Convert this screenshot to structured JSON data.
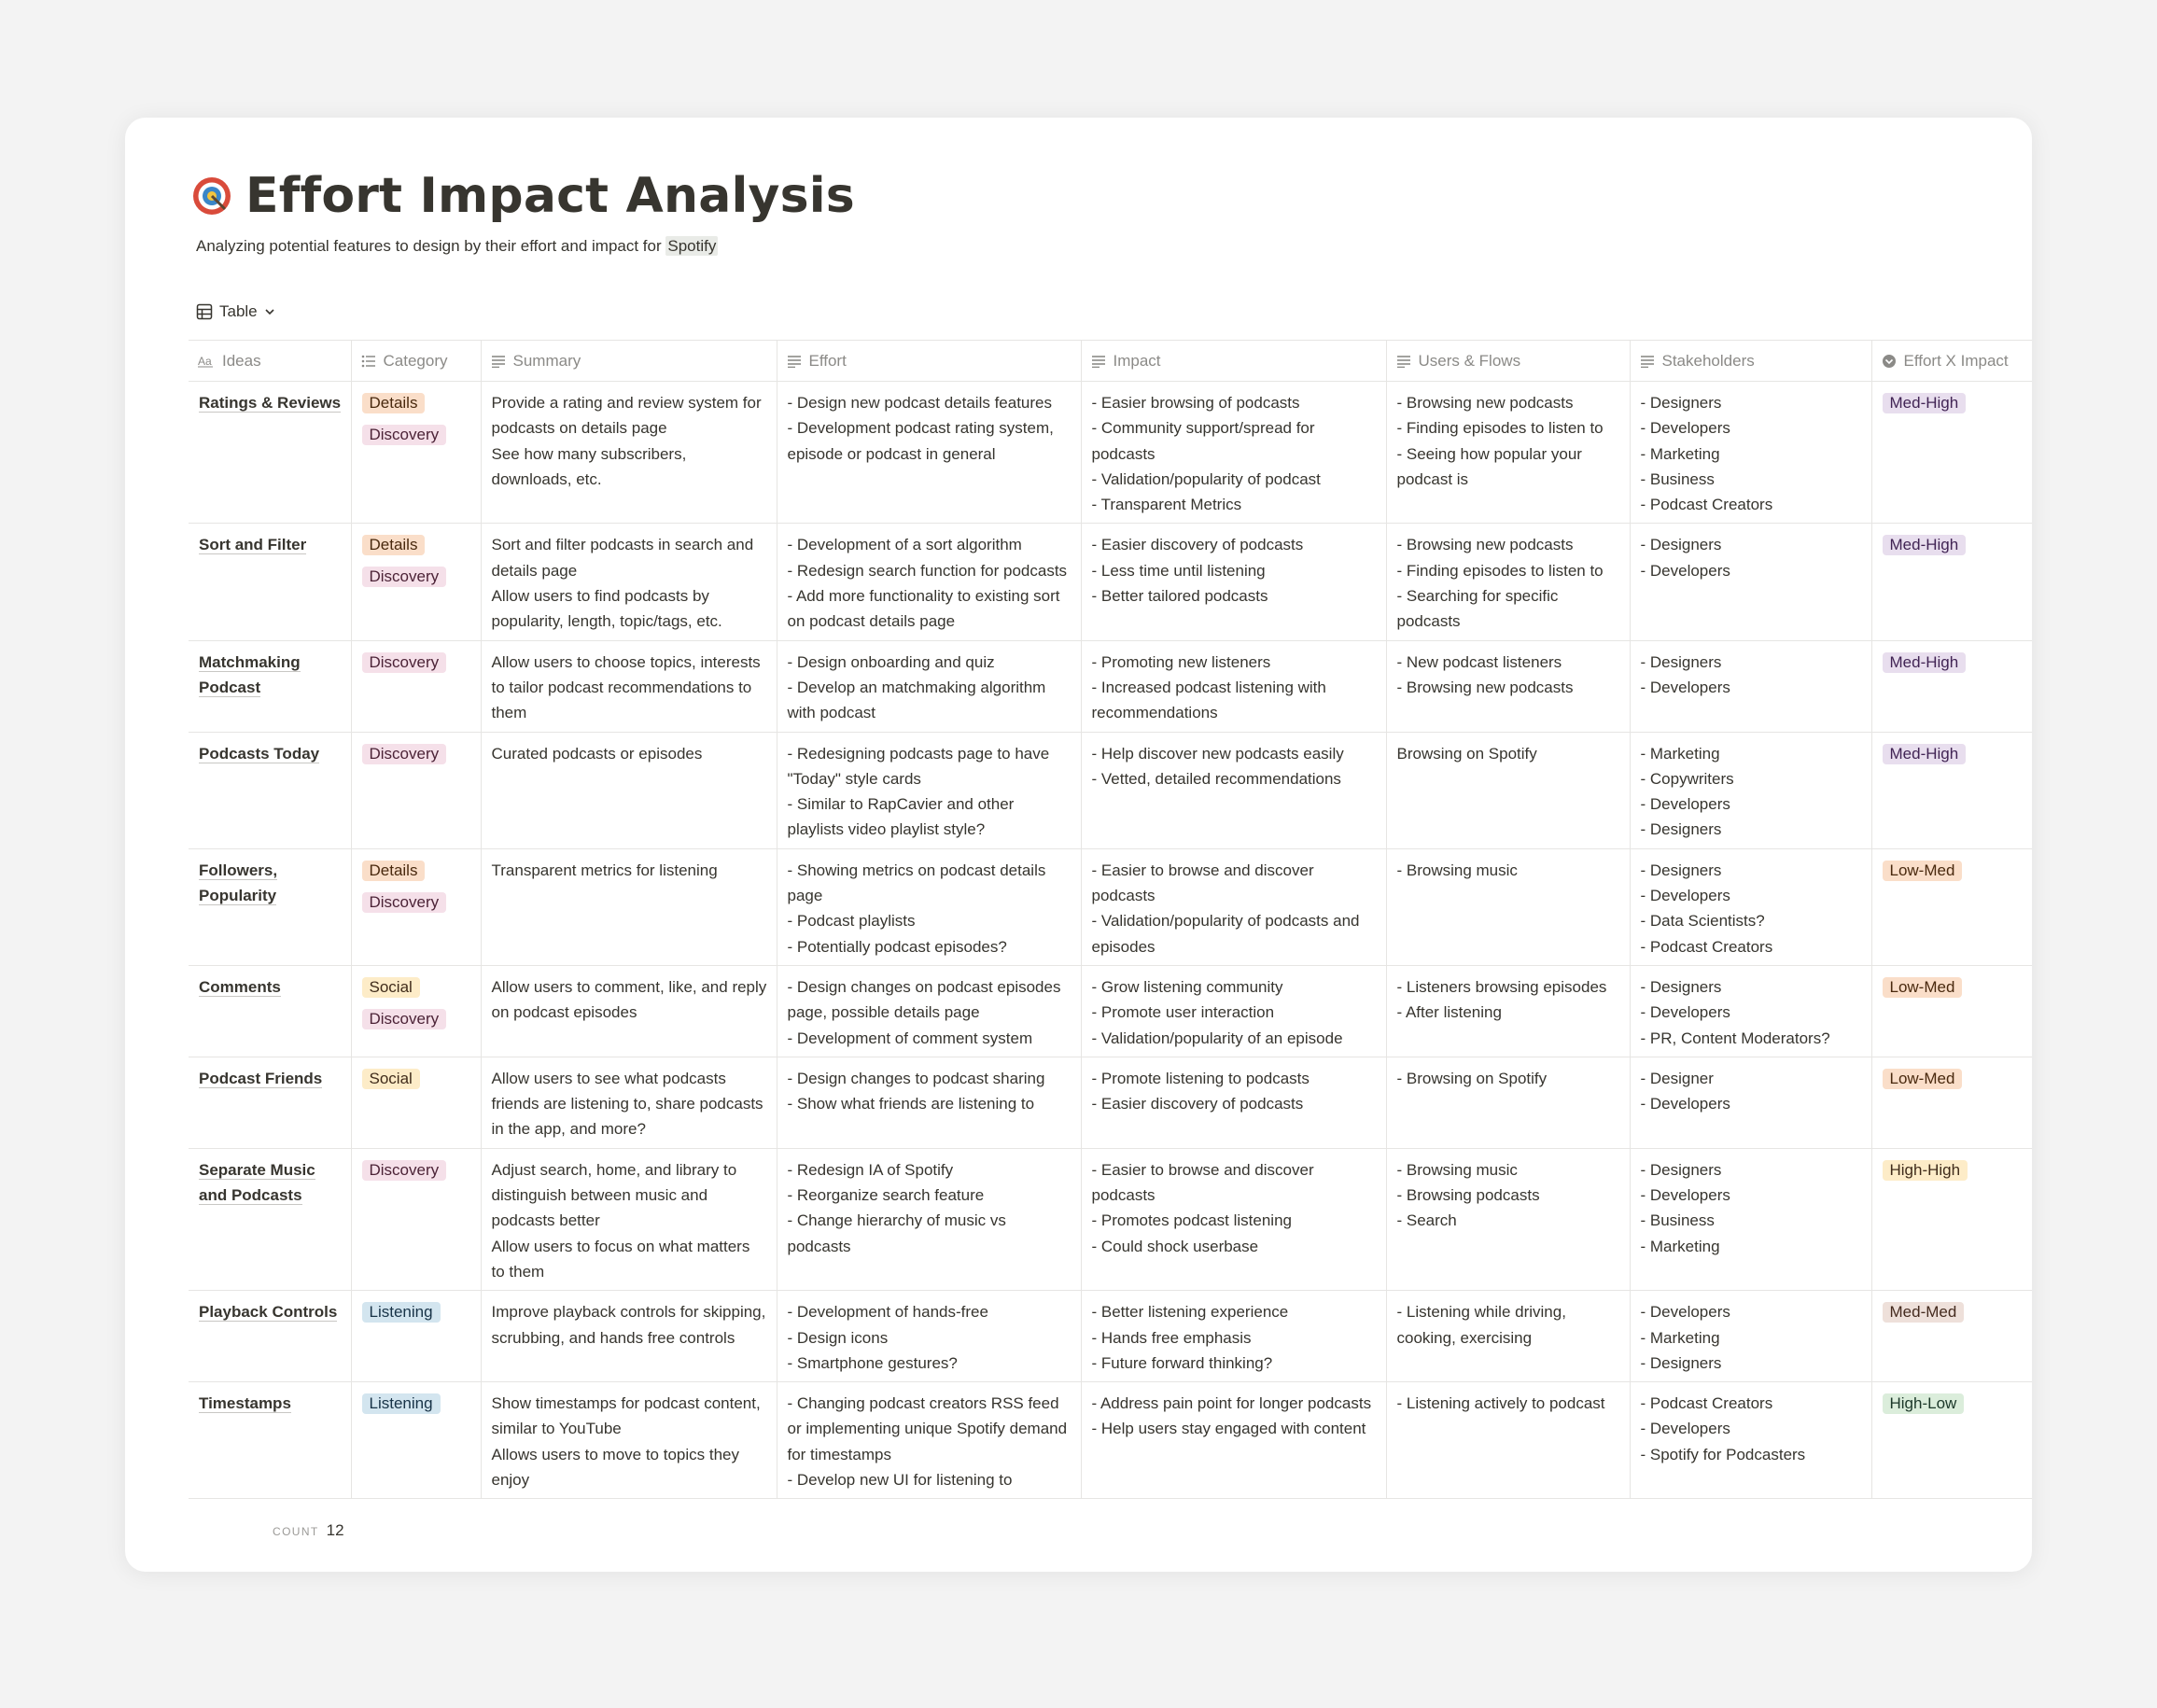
{
  "page": {
    "title": "Effort Impact Analysis",
    "icon": "target-icon",
    "subtitle_prefix": "Analyzing potential features to design by their effort and impact for ",
    "subtitle_highlight": "Spotify"
  },
  "view": {
    "label": "Table",
    "icon": "table-icon"
  },
  "columns": [
    {
      "label": "Ideas",
      "icon": "title-icon"
    },
    {
      "label": "Category",
      "icon": "multi-select-icon"
    },
    {
      "label": "Summary",
      "icon": "text-icon"
    },
    {
      "label": "Effort",
      "icon": "text-icon"
    },
    {
      "label": "Impact",
      "icon": "text-icon"
    },
    {
      "label": "Users & Flows",
      "icon": "text-icon"
    },
    {
      "label": "Stakeholders",
      "icon": "text-icon"
    },
    {
      "label": "Effort X Impact",
      "icon": "select-icon"
    }
  ],
  "tag_colors": {
    "Details": {
      "bg": "#fadec9",
      "fg": "#49290e"
    },
    "Discovery": {
      "bg": "#f5e0e9",
      "fg": "#4c2337"
    },
    "Social": {
      "bg": "#fdecc8",
      "fg": "#402c1b"
    },
    "Listening": {
      "bg": "#d3e5ef",
      "fg": "#183347"
    },
    "Med-High": {
      "bg": "#e8deee",
      "fg": "#412454"
    },
    "Low-Med": {
      "bg": "#fadec9",
      "fg": "#49290e"
    },
    "High-High": {
      "bg": "#fdecc8",
      "fg": "#402c1b"
    },
    "Med-Med": {
      "bg": "#eee0da",
      "fg": "#442a1e"
    },
    "High-Low": {
      "bg": "#dbeddb",
      "fg": "#1c3829"
    }
  },
  "rows": [
    {
      "idea": "Ratings & Reviews",
      "categories": [
        "Details",
        "Discovery"
      ],
      "summary": [
        "Provide a rating and review system for podcasts on details page",
        "See how many subscribers, downloads, etc."
      ],
      "effort": [
        "- Design new podcast details features",
        "- Development podcast rating system, episode or podcast in general"
      ],
      "impact": [
        "- Easier browsing of podcasts",
        "- Community support/spread for podcasts",
        "- Validation/popularity of podcast",
        "- Transparent Metrics"
      ],
      "users_flows": [
        "- Browsing new podcasts",
        "- Finding episodes to listen to",
        "- Seeing how popular your podcast is"
      ],
      "stakeholders": [
        "- Designers",
        "- Developers",
        "- Marketing",
        "- Business",
        "- Podcast Creators"
      ],
      "effort_x_impact": "Med-High"
    },
    {
      "idea": "Sort and Filter",
      "categories": [
        "Details",
        "Discovery"
      ],
      "summary": [
        "Sort and filter podcasts in search and details page",
        "Allow users to find podcasts by popularity, length, topic/tags, etc."
      ],
      "effort": [
        "- Development of a sort algorithm",
        "- Redesign search function for podcasts",
        "- Add more functionality to existing sort on podcast details page"
      ],
      "impact": [
        "- Easier discovery of podcasts",
        "- Less time until listening",
        "- Better tailored podcasts"
      ],
      "users_flows": [
        "- Browsing new podcasts",
        "- Finding episodes to listen to",
        "- Searching for specific podcasts"
      ],
      "stakeholders": [
        "- Designers",
        "- Developers"
      ],
      "effort_x_impact": "Med-High"
    },
    {
      "idea": "Matchmaking Podcast",
      "categories": [
        "Discovery"
      ],
      "summary": [
        "Allow users to choose topics, interests to tailor podcast recommendations to them"
      ],
      "effort": [
        "- Design onboarding and quiz",
        "- Develop an matchmaking algorithm with podcast"
      ],
      "impact": [
        "- Promoting new listeners",
        "- Increased podcast listening with recommendations"
      ],
      "users_flows": [
        "- New podcast listeners",
        "- Browsing new podcasts"
      ],
      "stakeholders": [
        "- Designers",
        "- Developers"
      ],
      "effort_x_impact": "Med-High"
    },
    {
      "idea": "Podcasts Today",
      "categories": [
        "Discovery"
      ],
      "summary": [
        "Curated podcasts or episodes"
      ],
      "effort": [
        "- Redesigning podcasts page to have \"Today\" style cards",
        "- Similar to RapCavier and other playlists video playlist style?"
      ],
      "impact": [
        "- Help discover new podcasts easily",
        "- Vetted, detailed recommendations"
      ],
      "users_flows": [
        "Browsing on Spotify"
      ],
      "stakeholders": [
        "- Marketing",
        "- Copywriters",
        "- Developers",
        "- Designers"
      ],
      "effort_x_impact": "Med-High"
    },
    {
      "idea": "Followers, Popularity",
      "categories": [
        "Details",
        "Discovery"
      ],
      "summary": [
        "Transparent metrics for listening"
      ],
      "effort": [
        "- Showing metrics on podcast details page",
        "- Podcast playlists",
        "- Potentially podcast episodes?"
      ],
      "impact": [
        "- Easier to browse and discover podcasts",
        "- Validation/popularity of podcasts and episodes"
      ],
      "users_flows": [
        "- Browsing music"
      ],
      "stakeholders": [
        "- Designers",
        "- Developers",
        "- Data Scientists?",
        "- Podcast Creators"
      ],
      "effort_x_impact": "Low-Med"
    },
    {
      "idea": "Comments",
      "categories": [
        "Social",
        "Discovery"
      ],
      "summary": [
        "Allow users to comment, like, and reply on podcast episodes"
      ],
      "effort": [
        "- Design changes on podcast episodes page, possible details page",
        "- Development of comment system"
      ],
      "impact": [
        "- Grow listening community",
        "- Promote user interaction",
        "- Validation/popularity of an episode"
      ],
      "users_flows": [
        "- Listeners browsing episodes",
        "- After listening"
      ],
      "stakeholders": [
        "- Designers",
        "- Developers",
        "- PR, Content Moderators?"
      ],
      "effort_x_impact": "Low-Med"
    },
    {
      "idea": "Podcast Friends",
      "categories": [
        "Social"
      ],
      "summary": [
        "Allow users to see what podcasts friends are listening to, share podcasts in the app, and more?"
      ],
      "effort": [
        "- Design changes to podcast sharing",
        "- Show what friends are listening to"
      ],
      "impact": [
        "- Promote listening to podcasts",
        "- Easier discovery of podcasts"
      ],
      "users_flows": [
        "- Browsing on Spotify"
      ],
      "stakeholders": [
        "- Designer",
        "- Developers"
      ],
      "effort_x_impact": "Low-Med"
    },
    {
      "idea": "Separate Music and Podcasts",
      "categories": [
        "Discovery"
      ],
      "summary": [
        "Adjust search, home, and library to distinguish between music and podcasts better",
        "Allow users to focus on what matters to them"
      ],
      "effort": [
        "- Redesign IA of Spotify",
        "- Reorganize search feature",
        "- Change hierarchy of music vs podcasts"
      ],
      "impact": [
        "- Easier to browse and discover podcasts",
        "- Promotes podcast listening",
        "- Could shock userbase"
      ],
      "users_flows": [
        "- Browsing music",
        "- Browsing podcasts",
        "- Search"
      ],
      "stakeholders": [
        "- Designers",
        "- Developers",
        "- Business",
        "- Marketing"
      ],
      "effort_x_impact": "High-High"
    },
    {
      "idea": "Playback Controls",
      "categories": [
        "Listening"
      ],
      "summary": [
        "Improve playback controls for skipping, scrubbing, and hands free controls"
      ],
      "effort": [
        "- Development of hands-free",
        "- Design icons",
        "- Smartphone gestures?"
      ],
      "impact": [
        "- Better listening experience",
        "- Hands free emphasis",
        "- Future forward thinking?"
      ],
      "users_flows": [
        "- Listening while driving, cooking, exercising"
      ],
      "stakeholders": [
        "- Developers",
        "- Marketing",
        "- Designers"
      ],
      "effort_x_impact": "Med-Med"
    },
    {
      "idea": "Timestamps",
      "categories": [
        "Listening"
      ],
      "summary": [
        "Show timestamps for podcast content, similar to YouTube",
        "Allows users to move to topics they enjoy"
      ],
      "effort": [
        "- Changing podcast creators RSS feed or implementing unique Spotify demand for timestamps",
        "- Develop new UI for listening to"
      ],
      "impact": [
        "- Address pain point for longer podcasts",
        "- Help users stay engaged with content"
      ],
      "users_flows": [
        "- Listening actively to podcast"
      ],
      "stakeholders": [
        "- Podcast Creators",
        "- Developers",
        "- Spotify for Podcasters"
      ],
      "effort_x_impact": "High-Low"
    }
  ],
  "footer": {
    "label": "COUNT",
    "value": "12"
  }
}
